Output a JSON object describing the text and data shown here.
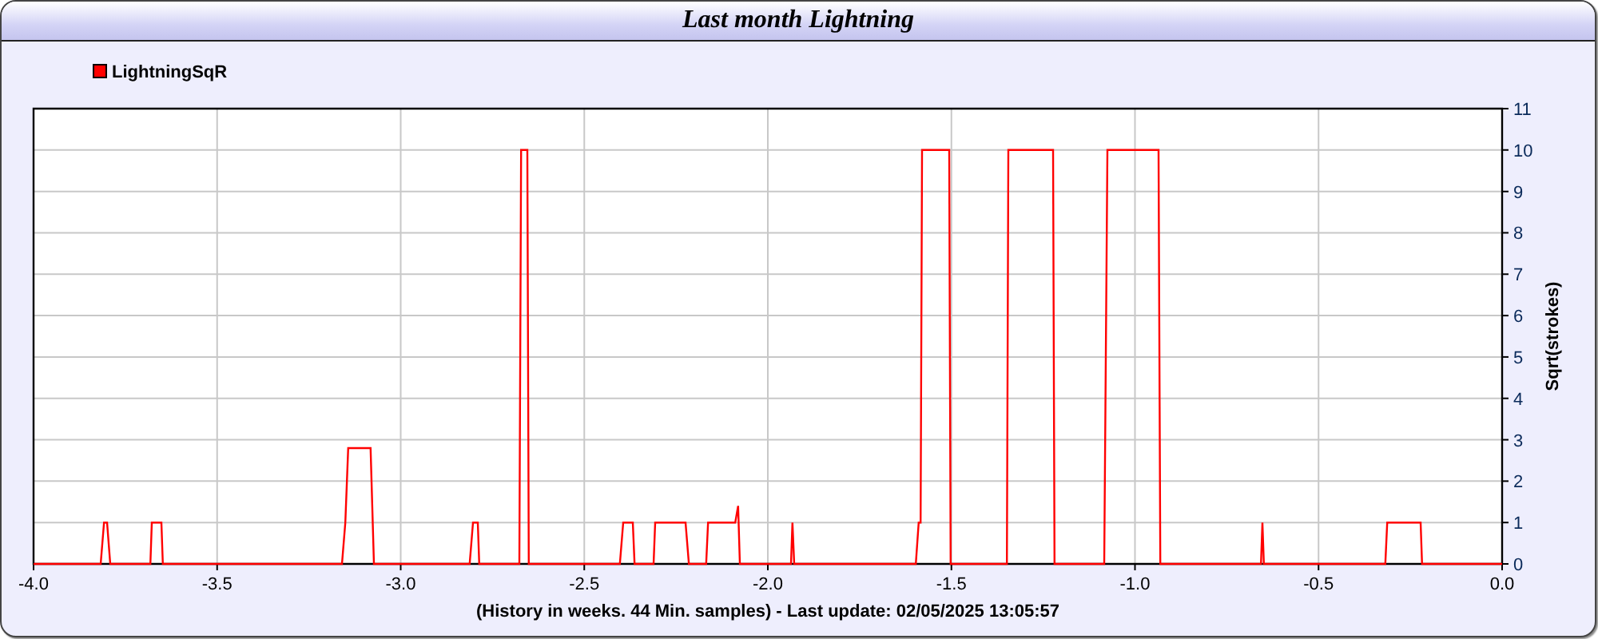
{
  "window": {
    "title": "Last month Lightning"
  },
  "chart": {
    "chart_data": {
      "type": "line",
      "xlabel": "(History in weeks. 44 Min. samples) - Last update: 02/05/2025 13:05:57",
      "ylabel": "Sqrt(strokes)",
      "x": [
        -4.0,
        -3.817,
        -3.808,
        -3.8,
        -3.791,
        -3.682,
        -3.678,
        -3.652,
        -3.648,
        -3.16,
        -3.151,
        -3.143,
        -3.082,
        -3.073,
        -2.812,
        -2.803,
        -2.79,
        -2.786,
        -2.677,
        -2.672,
        -2.655,
        -2.651,
        -2.403,
        -2.394,
        -2.368,
        -2.363,
        -2.311,
        -2.307,
        -2.224,
        -2.215,
        -2.168,
        -2.163,
        -2.089,
        -2.081,
        -2.076,
        -1.937,
        -1.933,
        -1.928,
        -1.597,
        -1.589,
        -1.584,
        -1.58,
        -1.506,
        -1.502,
        -1.349,
        -1.345,
        -1.223,
        -1.219,
        -1.084,
        -1.075,
        -0.936,
        -0.931,
        -0.657,
        -0.653,
        -0.649,
        -0.318,
        -0.313,
        -0.222,
        -0.218,
        0.0
      ],
      "series": [
        {
          "name": "LightningSqR",
          "color": "#ff0000",
          "values": [
            0,
            0,
            1,
            1,
            0,
            0,
            1,
            1,
            0,
            0,
            1,
            2.8,
            2.8,
            0,
            0,
            1,
            1,
            0,
            0,
            10,
            10,
            0,
            0,
            1,
            1,
            0,
            0,
            1,
            1,
            0,
            0,
            1,
            1,
            1.4,
            0,
            0,
            1,
            0,
            0,
            1,
            1,
            10,
            10,
            0,
            0,
            10,
            10,
            0,
            0,
            10,
            10,
            0,
            0,
            1,
            0,
            0,
            1,
            1,
            0,
            0
          ]
        }
      ],
      "grid": true,
      "xlim": [
        -4,
        0
      ],
      "ylim": [
        0,
        11
      ],
      "xticks": [
        {
          "value": -4,
          "label": "-4.0"
        },
        {
          "value": -3.5,
          "label": "-3.5"
        },
        {
          "value": -3,
          "label": "-3.0"
        },
        {
          "value": -2.5,
          "label": "-2.5"
        },
        {
          "value": -2,
          "label": "-2.0"
        },
        {
          "value": -1.5,
          "label": "-1.5"
        },
        {
          "value": -1,
          "label": "-1.0"
        },
        {
          "value": -0.5,
          "label": "-0.5"
        },
        {
          "value": 0,
          "label": "0.0"
        }
      ],
      "yticks": [
        0,
        1,
        2,
        3,
        4,
        5,
        6,
        7,
        8,
        9,
        10,
        11
      ]
    }
  }
}
